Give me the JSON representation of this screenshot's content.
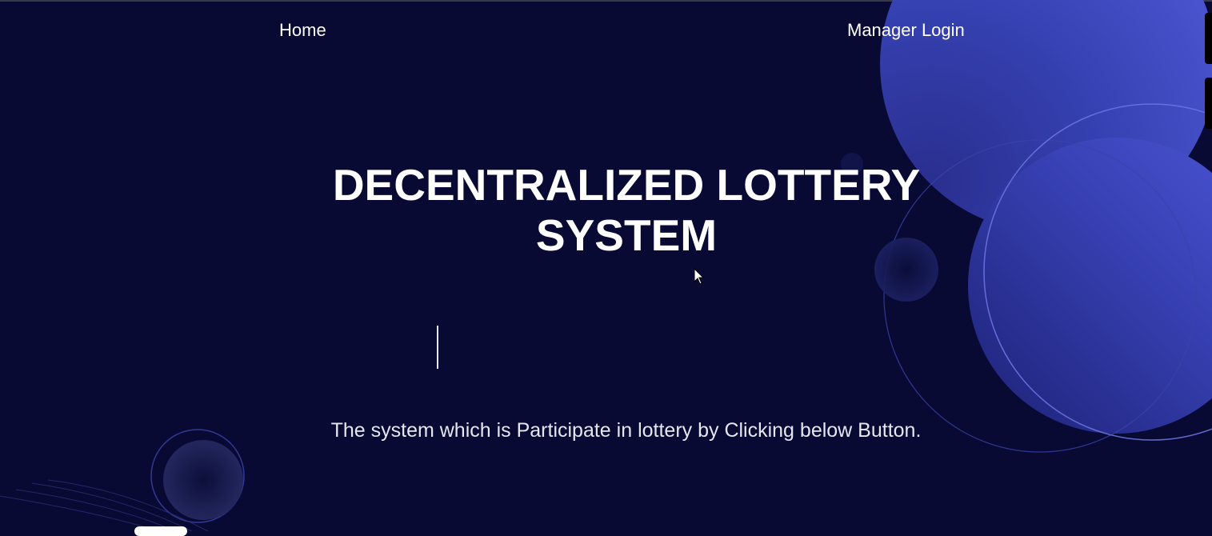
{
  "nav": {
    "home_label": "Home",
    "manager_login_label": "Manager Login"
  },
  "hero": {
    "title": "DECENTRALIZED LOTTERY SYSTEM",
    "description": "The system which is Participate in lottery by Clicking below Button."
  },
  "colors": {
    "background": "#080a33",
    "accent": "#3b44b8",
    "text": "#ffffff"
  }
}
